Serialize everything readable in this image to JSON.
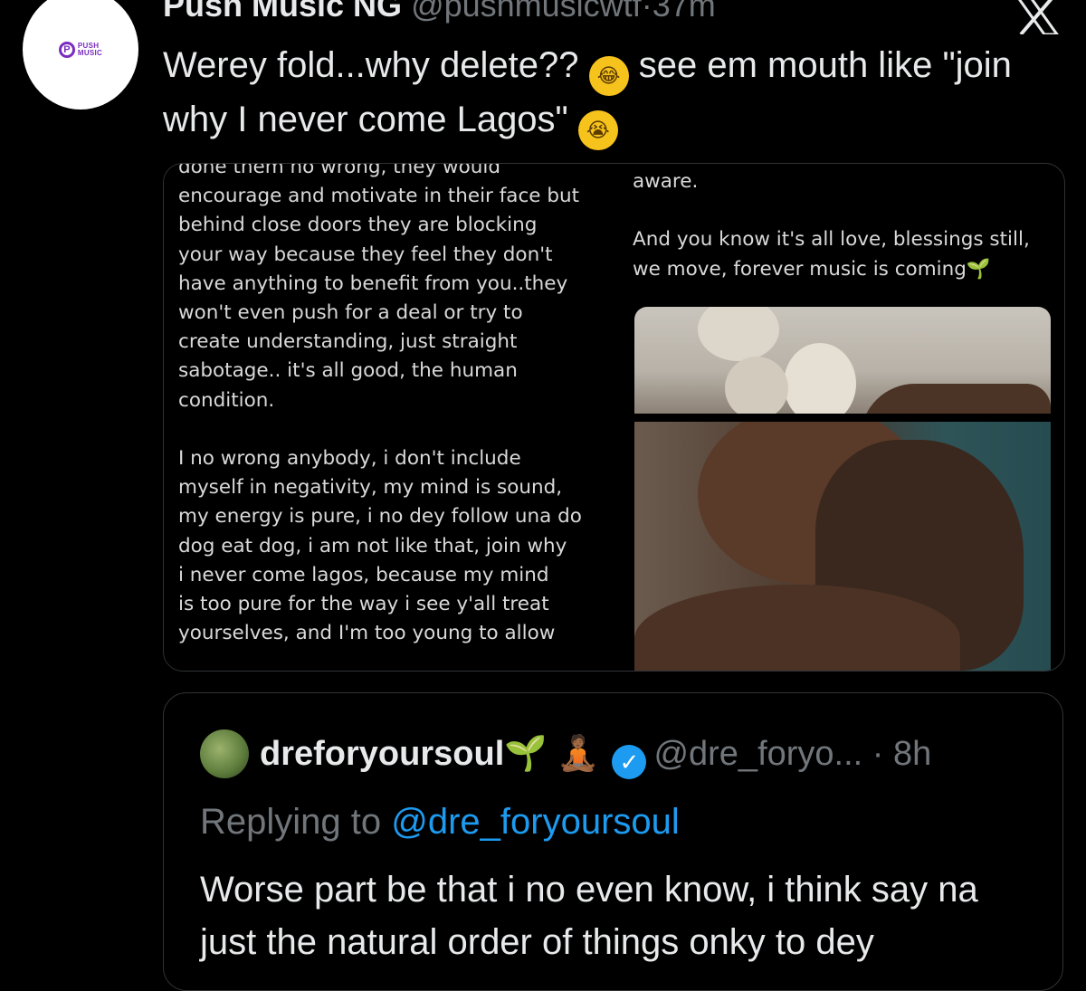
{
  "tweet": {
    "author_name": "Push Music NG",
    "author_handle": "@pushmusicwtf",
    "time": "37m",
    "avatar_logo_text_line1": "PUSH",
    "avatar_logo_text_line2": "MUSIC",
    "text_part1": "Werey fold...why delete?? ",
    "text_part2": " see em mouth like \"join why I never come Lagos\" ",
    "emoji1": "😂",
    "emoji2": "😭"
  },
  "attachment": {
    "left_text": "done them no wrong, they would\nencourage and motivate in their face but\nbehind close doors they are blocking\nyour way because they feel they don't\nhave anything to benefit from you..they\nwon't even push for a deal or try to\ncreate understanding, just straight\nsabotage.. it's all good, the human\ncondition.\n\nI no wrong anybody, i don't include\nmyself in negativity, my mind is sound,\nmy energy is pure, i no dey follow una do\ndog eat dog, i am not like that, join why\ni never come lagos, because my mind\nis too pure for the way i see y'all treat\nyourselves, and I'm too young to allow",
    "right_text": "aware.\n\nAnd you know it's all love, blessings still,\nwe move, forever music is coming🌱"
  },
  "quote": {
    "name": "dreforyoursoul🌱 🧘🏾",
    "handle": "@dre_foryo...",
    "time": "8h",
    "replying_prefix": "Replying to ",
    "replying_handle": "@dre_foryoursoul",
    "text": "Worse part be that i no even know, i think say na just the natural order of things onky to dey"
  },
  "colors": {
    "background": "#000000",
    "text": "#e7e9ea",
    "muted": "#71767b",
    "link": "#1d9bf0",
    "border": "#2f3336",
    "brand": "#7b2cbf"
  },
  "icons": [
    "x-logo-icon",
    "verified-badge-icon"
  ]
}
